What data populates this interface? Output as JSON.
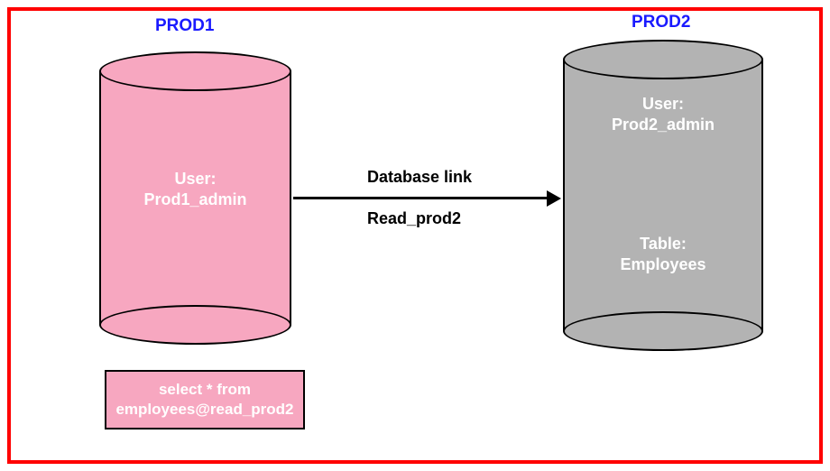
{
  "db1": {
    "title": "PROD1",
    "user_label": "User:",
    "user_value": "Prod1_admin"
  },
  "db2": {
    "title": "PROD2",
    "user_label": "User:",
    "user_value": "Prod2_admin",
    "table_label": "Table:",
    "table_value": "Employees"
  },
  "link": {
    "label1": "Database link",
    "label2": "Read_prod2"
  },
  "sql": {
    "line1": "select * from",
    "line2": "employees@read_prod2"
  },
  "colors": {
    "db1_fill": "#f7a7c0",
    "db2_fill": "#b3b3b3",
    "border": "#ff0000",
    "title": "#1a1aff"
  }
}
